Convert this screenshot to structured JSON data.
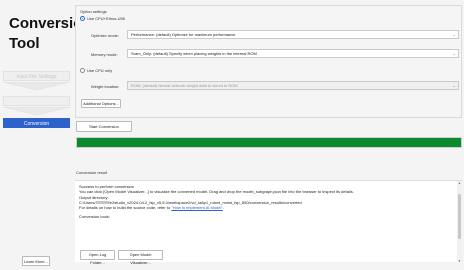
{
  "app": {
    "title_line1": "Conversion",
    "title_line2": "Tool"
  },
  "sidebar": {
    "items": [
      {
        "label": "Input File Settings",
        "state": "disabled"
      },
      {
        "label": "",
        "state": "disabled"
      },
      {
        "label": "Conversion",
        "state": "active"
      }
    ],
    "learn_more": "Learn More..."
  },
  "options": {
    "section_title": "Option settings",
    "use_cpu_ethos": "Use CPU+Ethos-U55",
    "optimize_mode_label": "Optimize mode:",
    "optimize_mode_value": "Performance: (default) Optimize for maximum performance",
    "memory_mode_label": "Memory mode:",
    "memory_mode_value": "Sram_Only: (default) Specify when placing weights in the internal ROM",
    "use_cpu_only": "Use CPU only",
    "weight_location_label": "Weight location:",
    "weight_location_value": "ROM: (default) Neural network weight data is stored in ROM",
    "additional_options": "Additional Options..."
  },
  "start_conversion": "Start Conversion",
  "progress": {
    "percent": 100,
    "color": "#0c8a2e"
  },
  "result": {
    "title": "Conversion result",
    "lines": {
      "l1": "Success to perform conversion",
      "l2": "You can click [Open Model Visualizer...] to visualize the converted model. Drag and drop the model_subgraph.json file into the browser to inspect its details.",
      "l3": "Output directory:",
      "l4_prefix": "C:/Users/",
      "l4_suffix": "/e2studio_v2024-04.2_fsp_v5.5.0/workspace2/vd_ra8p1_ruhmi_mnist_fsp_850/conversion_results/converted",
      "l5_prefix": "For details on how to build the source code, refer to ",
      "l5_link": "\"How to implement AI Model\"",
      "l5_suffix": ".",
      "l6": "Conversion tools:"
    }
  },
  "buttons": {
    "open_log_folder": "Open Log Folder...",
    "open_model_visualizer": "Open Model Visualizer..."
  },
  "colors": {
    "accent": "#2c62c9",
    "progress": "#0c8a2e"
  }
}
